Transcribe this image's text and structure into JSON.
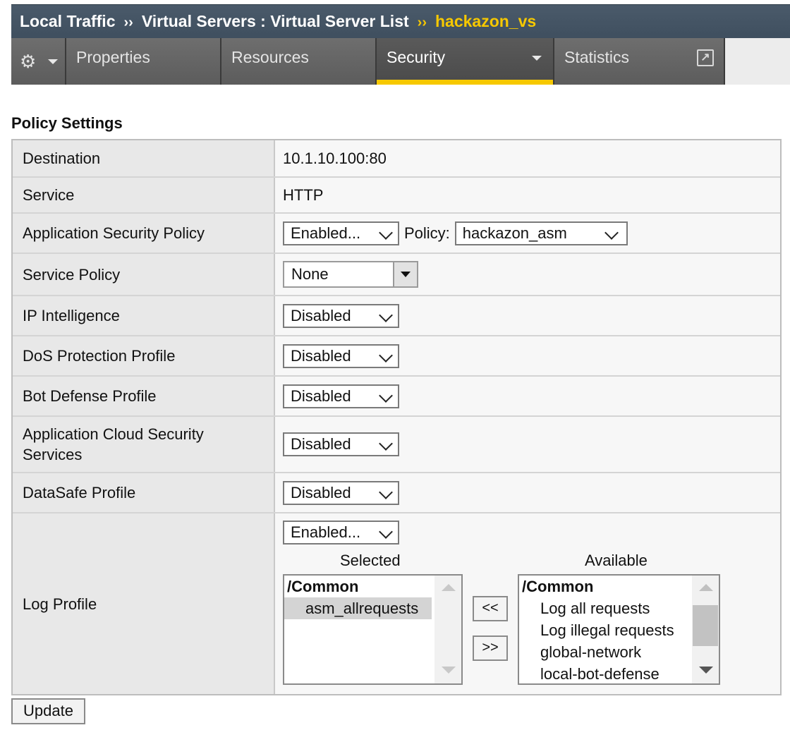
{
  "breadcrumb": {
    "part1": "Local Traffic",
    "sep1": "››",
    "part2": "Virtual Servers : Virtual Server List",
    "sep2": "››",
    "current": "hackazon_vs"
  },
  "tabs": {
    "gear_icon": "gear-icon",
    "properties": "Properties",
    "resources": "Resources",
    "security": "Security",
    "statistics": "Statistics",
    "statistics_icon": "external-link-icon",
    "active": "Security",
    "active_color": "#f6c800"
  },
  "section_title": "Policy Settings",
  "rows": {
    "destination": {
      "label": "Destination",
      "value": "10.1.10.100:80"
    },
    "service": {
      "label": "Service",
      "value": "HTTP"
    },
    "asp": {
      "label": "Application Security Policy",
      "value": "Enabled...",
      "policy_label": "Policy:",
      "policy_value": "hackazon_asm"
    },
    "service_policy": {
      "label": "Service Policy",
      "value": "None"
    },
    "ip_intel": {
      "label": "IP Intelligence",
      "value": "Disabled"
    },
    "dos": {
      "label": "DoS Protection Profile",
      "value": "Disabled"
    },
    "bot": {
      "label": "Bot Defense Profile",
      "value": "Disabled"
    },
    "acss": {
      "label_line1": "Application Cloud Security",
      "label_line2": "Services",
      "value": "Disabled"
    },
    "datasafe": {
      "label": "DataSafe Profile",
      "value": "Disabled"
    },
    "log": {
      "label": "Log Profile",
      "value": "Enabled...",
      "selected_header": "Selected",
      "available_header": "Available",
      "selected_group": "/Common",
      "selected_items": [
        "asm_allrequests"
      ],
      "available_group": "/Common",
      "available_items": [
        "Log all requests",
        "Log illegal requests",
        "global-network",
        "local-bot-defense"
      ],
      "move_left": "<<",
      "move_right": ">>"
    }
  },
  "update_button": "Update"
}
